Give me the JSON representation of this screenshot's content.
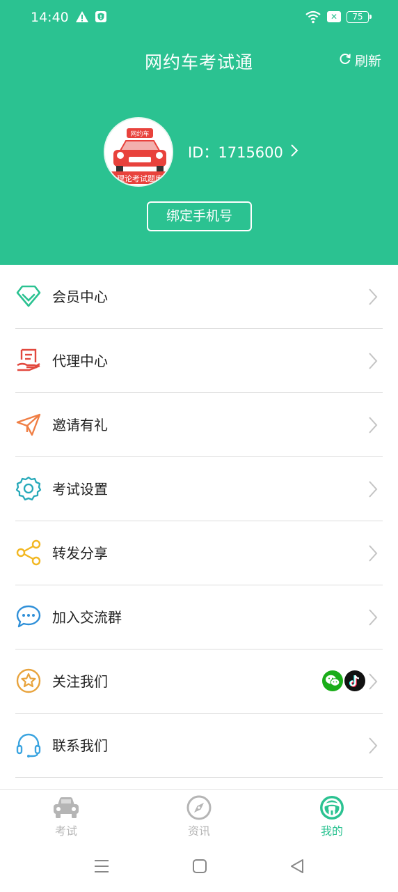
{
  "status_bar": {
    "time": "14:40",
    "battery": "75",
    "icons": [
      "warning-icon",
      "shield-icon",
      "wifi-icon",
      "sim-off-icon",
      "battery-icon"
    ]
  },
  "header": {
    "title": "网约车考试通",
    "refresh_label": "刷新",
    "avatar": {
      "badge_text": "网约车",
      "banner_text": "理论考试题库"
    },
    "user_id": "ID：1715600",
    "bind_phone_label": "绑定手机号"
  },
  "menu": [
    {
      "label": "会员中心",
      "icon": "diamond-icon"
    },
    {
      "label": "代理中心",
      "icon": "agent-document-icon"
    },
    {
      "label": "邀请有礼",
      "icon": "paper-plane-icon"
    },
    {
      "label": "考试设置",
      "icon": "gear-icon"
    },
    {
      "label": "转发分享",
      "icon": "share-icon"
    },
    {
      "label": "加入交流群",
      "icon": "chat-bubble-icon"
    },
    {
      "label": "关注我们",
      "icon": "star-icon",
      "extras": [
        "wechat-icon",
        "tiktok-icon"
      ]
    },
    {
      "label": "联系我们",
      "icon": "headset-icon"
    }
  ],
  "tabbar": {
    "tabs": [
      {
        "label": "考试",
        "icon": "car-icon",
        "active": false
      },
      {
        "label": "资讯",
        "icon": "compass-icon",
        "active": false
      },
      {
        "label": "我的",
        "icon": "steering-wheel-icon",
        "active": true
      }
    ]
  },
  "colors": {
    "brand": "#2bc291",
    "divider": "#dcdcdc",
    "inactive": "#b5b5b5"
  }
}
